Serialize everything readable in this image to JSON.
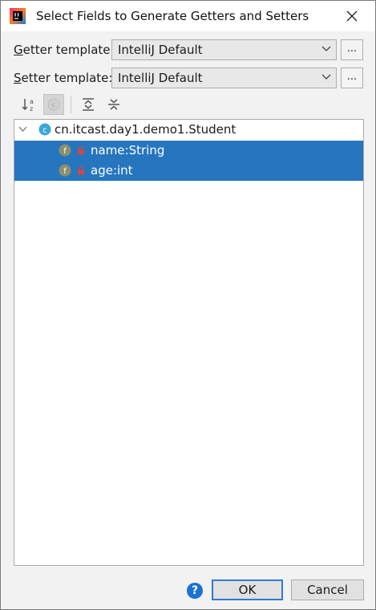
{
  "window": {
    "title": "Select Fields to Generate Getters and Setters",
    "close_glyph": "✕"
  },
  "getter": {
    "label_mnemonic": "G",
    "label_rest": "etter template:",
    "value": "IntelliJ Default",
    "more": "..."
  },
  "setter": {
    "label_mnemonic": "S",
    "label_rest": "etter template:",
    "value": "IntelliJ Default",
    "more": "..."
  },
  "toolbar": {
    "icons": [
      "sort-alphabetically-icon",
      "show-classes-icon",
      "expand-all-icon",
      "collapse-all-icon"
    ]
  },
  "tree": {
    "root": {
      "label": "cn.itcast.day1.demo1.Student",
      "icon_letter": "c",
      "expanded": true
    },
    "fields": [
      {
        "label": "name:String",
        "icon_letter": "f",
        "selected": true
      },
      {
        "label": "age:int",
        "icon_letter": "f",
        "selected": true
      }
    ]
  },
  "buttons": {
    "help": "?",
    "ok": "OK",
    "cancel": "Cancel"
  },
  "colors": {
    "selection": "#2675bf",
    "class_icon": "#3aa7dc",
    "field_icon": "#8c8e6c",
    "lock_icon": "#c94a4a",
    "help": "#1a73d1"
  }
}
